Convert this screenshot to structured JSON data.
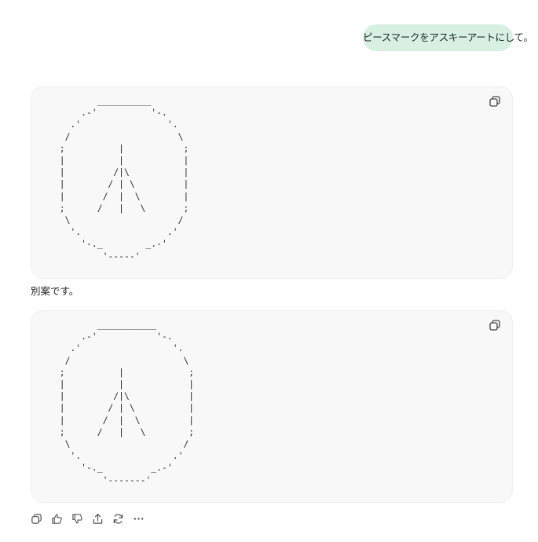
{
  "user_message": "ピースマークをアスキーアートにして。",
  "code_blocks": [
    {
      "code": "         __________\n      .-'          '-.\n    .'                '.\n   /                    \\\n  ;          |           ;\n  |          |           |\n  |         /|\\          |\n  |        / | \\         |\n  |       /  |  \\        |\n  ;      /   |   \\       ;\n   \\                    /\n    '.                .'\n      '-._        _.-'\n          '-----'"
    },
    {
      "code": "         ___________\n      .-'           '-.\n    .'                 '.\n   /                     \\\n  ;          |            ;\n  |          |            |\n  |         /|\\           |\n  |        / | \\          |\n  |       /  |  \\         |\n  ;      /   |   \\        ;\n   \\                     /\n    '.                 .'\n      '-._         _.-'\n          '-------'"
    }
  ],
  "between_text": "別案です。",
  "icons": {
    "copy": "copy-icon",
    "actions": [
      "copy-icon",
      "thumbs-up-icon",
      "thumbs-down-icon",
      "share-icon",
      "regenerate-icon",
      "more-icon"
    ]
  }
}
